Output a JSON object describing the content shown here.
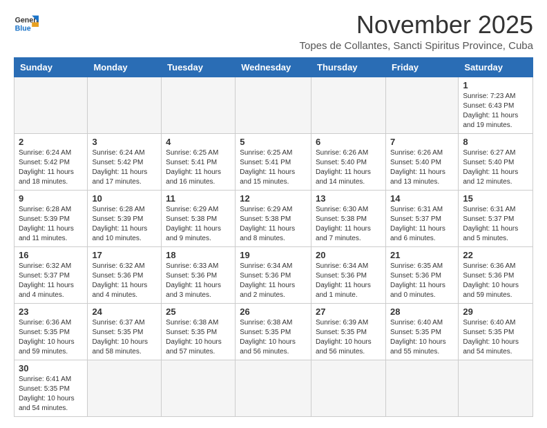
{
  "header": {
    "logo_general": "General",
    "logo_blue": "Blue",
    "month": "November 2025",
    "location": "Topes de Collantes, Sancti Spiritus Province, Cuba"
  },
  "weekdays": [
    "Sunday",
    "Monday",
    "Tuesday",
    "Wednesday",
    "Thursday",
    "Friday",
    "Saturday"
  ],
  "weeks": [
    [
      {
        "day": "",
        "info": ""
      },
      {
        "day": "",
        "info": ""
      },
      {
        "day": "",
        "info": ""
      },
      {
        "day": "",
        "info": ""
      },
      {
        "day": "",
        "info": ""
      },
      {
        "day": "",
        "info": ""
      },
      {
        "day": "1",
        "info": "Sunrise: 7:23 AM\nSunset: 6:43 PM\nDaylight: 11 hours and 19 minutes."
      }
    ],
    [
      {
        "day": "2",
        "info": "Sunrise: 6:24 AM\nSunset: 5:42 PM\nDaylight: 11 hours and 18 minutes."
      },
      {
        "day": "3",
        "info": "Sunrise: 6:24 AM\nSunset: 5:42 PM\nDaylight: 11 hours and 17 minutes."
      },
      {
        "day": "4",
        "info": "Sunrise: 6:25 AM\nSunset: 5:41 PM\nDaylight: 11 hours and 16 minutes."
      },
      {
        "day": "5",
        "info": "Sunrise: 6:25 AM\nSunset: 5:41 PM\nDaylight: 11 hours and 15 minutes."
      },
      {
        "day": "6",
        "info": "Sunrise: 6:26 AM\nSunset: 5:40 PM\nDaylight: 11 hours and 14 minutes."
      },
      {
        "day": "7",
        "info": "Sunrise: 6:26 AM\nSunset: 5:40 PM\nDaylight: 11 hours and 13 minutes."
      },
      {
        "day": "8",
        "info": "Sunrise: 6:27 AM\nSunset: 5:40 PM\nDaylight: 11 hours and 12 minutes."
      }
    ],
    [
      {
        "day": "9",
        "info": "Sunrise: 6:28 AM\nSunset: 5:39 PM\nDaylight: 11 hours and 11 minutes."
      },
      {
        "day": "10",
        "info": "Sunrise: 6:28 AM\nSunset: 5:39 PM\nDaylight: 11 hours and 10 minutes."
      },
      {
        "day": "11",
        "info": "Sunrise: 6:29 AM\nSunset: 5:38 PM\nDaylight: 11 hours and 9 minutes."
      },
      {
        "day": "12",
        "info": "Sunrise: 6:29 AM\nSunset: 5:38 PM\nDaylight: 11 hours and 8 minutes."
      },
      {
        "day": "13",
        "info": "Sunrise: 6:30 AM\nSunset: 5:38 PM\nDaylight: 11 hours and 7 minutes."
      },
      {
        "day": "14",
        "info": "Sunrise: 6:31 AM\nSunset: 5:37 PM\nDaylight: 11 hours and 6 minutes."
      },
      {
        "day": "15",
        "info": "Sunrise: 6:31 AM\nSunset: 5:37 PM\nDaylight: 11 hours and 5 minutes."
      }
    ],
    [
      {
        "day": "16",
        "info": "Sunrise: 6:32 AM\nSunset: 5:37 PM\nDaylight: 11 hours and 4 minutes."
      },
      {
        "day": "17",
        "info": "Sunrise: 6:32 AM\nSunset: 5:36 PM\nDaylight: 11 hours and 4 minutes."
      },
      {
        "day": "18",
        "info": "Sunrise: 6:33 AM\nSunset: 5:36 PM\nDaylight: 11 hours and 3 minutes."
      },
      {
        "day": "19",
        "info": "Sunrise: 6:34 AM\nSunset: 5:36 PM\nDaylight: 11 hours and 2 minutes."
      },
      {
        "day": "20",
        "info": "Sunrise: 6:34 AM\nSunset: 5:36 PM\nDaylight: 11 hours and 1 minute."
      },
      {
        "day": "21",
        "info": "Sunrise: 6:35 AM\nSunset: 5:36 PM\nDaylight: 11 hours and 0 minutes."
      },
      {
        "day": "22",
        "info": "Sunrise: 6:36 AM\nSunset: 5:36 PM\nDaylight: 10 hours and 59 minutes."
      }
    ],
    [
      {
        "day": "23",
        "info": "Sunrise: 6:36 AM\nSunset: 5:35 PM\nDaylight: 10 hours and 59 minutes."
      },
      {
        "day": "24",
        "info": "Sunrise: 6:37 AM\nSunset: 5:35 PM\nDaylight: 10 hours and 58 minutes."
      },
      {
        "day": "25",
        "info": "Sunrise: 6:38 AM\nSunset: 5:35 PM\nDaylight: 10 hours and 57 minutes."
      },
      {
        "day": "26",
        "info": "Sunrise: 6:38 AM\nSunset: 5:35 PM\nDaylight: 10 hours and 56 minutes."
      },
      {
        "day": "27",
        "info": "Sunrise: 6:39 AM\nSunset: 5:35 PM\nDaylight: 10 hours and 56 minutes."
      },
      {
        "day": "28",
        "info": "Sunrise: 6:40 AM\nSunset: 5:35 PM\nDaylight: 10 hours and 55 minutes."
      },
      {
        "day": "29",
        "info": "Sunrise: 6:40 AM\nSunset: 5:35 PM\nDaylight: 10 hours and 54 minutes."
      }
    ],
    [
      {
        "day": "30",
        "info": "Sunrise: 6:41 AM\nSunset: 5:35 PM\nDaylight: 10 hours and 54 minutes."
      },
      {
        "day": "",
        "info": ""
      },
      {
        "day": "",
        "info": ""
      },
      {
        "day": "",
        "info": ""
      },
      {
        "day": "",
        "info": ""
      },
      {
        "day": "",
        "info": ""
      },
      {
        "day": "",
        "info": ""
      }
    ]
  ]
}
